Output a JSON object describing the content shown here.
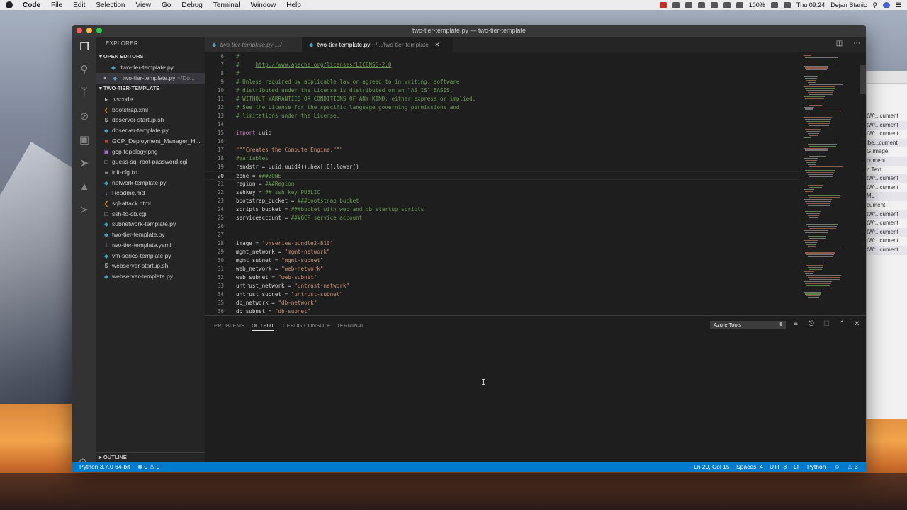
{
  "menubar": {
    "app": "Code",
    "items": [
      "File",
      "Edit",
      "Selection",
      "View",
      "Go",
      "Debug",
      "Terminal",
      "Window",
      "Help"
    ],
    "battery": "100%",
    "clock": "Thu 09:24",
    "user": "Dejan Stanic"
  },
  "window": {
    "title": "two-tier-template.py — two-tier-template"
  },
  "sidebar": {
    "title": "EXPLORER",
    "open_editors_header": "OPEN EDITORS",
    "open_editors": [
      {
        "name": "two-tier-template.py",
        "suffix": ""
      },
      {
        "name": "two-tier-template.py",
        "suffix": "~/Do..."
      }
    ],
    "project_header": "TWO-TIER-TEMPLATE",
    "files": [
      {
        "name": ".vscode",
        "icon": "folder",
        "color": "#cccccc"
      },
      {
        "name": "bootstrap.xml",
        "icon": "xml",
        "color": "#e37933"
      },
      {
        "name": "dbserver-startup.sh",
        "icon": "shell",
        "color": "#cccccc"
      },
      {
        "name": "dbserver-template.py",
        "icon": "python",
        "color": "#519aba"
      },
      {
        "name": "GCP_Deployment_Manager_H...",
        "icon": "pdf",
        "color": "#cc3e44"
      },
      {
        "name": "gcp-topology.png",
        "icon": "image",
        "color": "#a074c4"
      },
      {
        "name": "guess-sql-root-password.cgi",
        "icon": "file",
        "color": "#cccccc"
      },
      {
        "name": "init-cfg.txt",
        "icon": "text",
        "color": "#cccccc"
      },
      {
        "name": "network-template.py",
        "icon": "python",
        "color": "#519aba"
      },
      {
        "name": "Readme.md",
        "icon": "markdown",
        "color": "#519aba"
      },
      {
        "name": "sql-attack.html",
        "icon": "html",
        "color": "#e37933"
      },
      {
        "name": "ssh-to-db.cgi",
        "icon": "file",
        "color": "#cccccc"
      },
      {
        "name": "subnetwork-template.py",
        "icon": "python",
        "color": "#519aba"
      },
      {
        "name": "two-tier-template.py",
        "icon": "python",
        "color": "#519aba"
      },
      {
        "name": "two-tier-template.yaml",
        "icon": "yaml",
        "color": "#a074c4"
      },
      {
        "name": "vm-series-template.py",
        "icon": "python",
        "color": "#519aba"
      },
      {
        "name": "webserver-startup.sh",
        "icon": "shell",
        "color": "#cccccc"
      },
      {
        "name": "webserver-template.py",
        "icon": "python",
        "color": "#519aba"
      }
    ],
    "outline_header": "OUTLINE"
  },
  "tabs": [
    {
      "label": "two-tier-template.py",
      "path": ".../"
    },
    {
      "label": "two-tier-template.py",
      "path": "~/.../two-tier-template"
    }
  ],
  "code_lines": [
    {
      "n": "6",
      "segs": [
        {
          "t": "#",
          "c": "c-com"
        }
      ]
    },
    {
      "n": "7",
      "segs": [
        {
          "t": "#     ",
          "c": "c-com"
        },
        {
          "t": "http://www.apache.org/licenses/LICENSE-2.0",
          "c": "c-link"
        }
      ]
    },
    {
      "n": "8",
      "segs": [
        {
          "t": "#",
          "c": "c-com"
        }
      ]
    },
    {
      "n": "9",
      "segs": [
        {
          "t": "# Unless required by applicable law or agreed to in writing, software",
          "c": "c-com"
        }
      ]
    },
    {
      "n": "10",
      "segs": [
        {
          "t": "# distributed under the License is distributed on an \"AS IS\" BASIS,",
          "c": "c-com"
        }
      ]
    },
    {
      "n": "11",
      "segs": [
        {
          "t": "# WITHOUT WARRANTIES OR CONDITIONS OF ANY KIND, either express or implied.",
          "c": "c-com"
        }
      ]
    },
    {
      "n": "12",
      "segs": [
        {
          "t": "# See the License for the specific language governing permissions and",
          "c": "c-com"
        }
      ]
    },
    {
      "n": "13",
      "segs": [
        {
          "t": "# limitations under the License.",
          "c": "c-com"
        }
      ]
    },
    {
      "n": "14",
      "segs": []
    },
    {
      "n": "15",
      "segs": [
        {
          "t": "import",
          "c": "c-kw"
        },
        {
          "t": " uuid",
          "c": ""
        }
      ]
    },
    {
      "n": "16",
      "segs": []
    },
    {
      "n": "17",
      "segs": [
        {
          "t": "\"\"\"Creates the Compute Engine.\"\"\"",
          "c": "c-str"
        }
      ]
    },
    {
      "n": "18",
      "segs": [
        {
          "t": "#Variables",
          "c": "c-com"
        }
      ]
    },
    {
      "n": "19",
      "segs": [
        {
          "t": "randstr = uuid.uuid4().hex[:6].lower()",
          "c": ""
        }
      ]
    },
    {
      "n": "20",
      "segs": [
        {
          "t": "zone = ",
          "c": ""
        },
        {
          "t": "###ZONE",
          "c": "c-com"
        }
      ]
    },
    {
      "n": "21",
      "segs": [
        {
          "t": "region = ",
          "c": ""
        },
        {
          "t": "###Region",
          "c": "c-com"
        }
      ]
    },
    {
      "n": "22",
      "segs": [
        {
          "t": "sshkey = ",
          "c": ""
        },
        {
          "t": "## ssh key PUBLIC",
          "c": "c-com"
        }
      ]
    },
    {
      "n": "23",
      "segs": [
        {
          "t": "bootstrap_bucket = ",
          "c": ""
        },
        {
          "t": "###bootstrap bucket",
          "c": "c-com"
        }
      ]
    },
    {
      "n": "24",
      "segs": [
        {
          "t": "scripts_bucket = ",
          "c": ""
        },
        {
          "t": "###bucket with web and db startup scripts",
          "c": "c-com"
        }
      ]
    },
    {
      "n": "25",
      "segs": [
        {
          "t": "serviceaccount = ",
          "c": ""
        },
        {
          "t": "###GCP service account",
          "c": "c-com"
        }
      ]
    },
    {
      "n": "26",
      "segs": []
    },
    {
      "n": "27",
      "segs": []
    },
    {
      "n": "28",
      "segs": [
        {
          "t": "image = ",
          "c": ""
        },
        {
          "t": "\"vmseries-bundle2-810\"",
          "c": "c-str"
        }
      ]
    },
    {
      "n": "29",
      "segs": [
        {
          "t": "mgmt_network = ",
          "c": ""
        },
        {
          "t": "\"mgmt-network\"",
          "c": "c-str"
        }
      ]
    },
    {
      "n": "30",
      "segs": [
        {
          "t": "mgmt_subnet = ",
          "c": ""
        },
        {
          "t": "\"mgmt-subnet\"",
          "c": "c-str"
        }
      ]
    },
    {
      "n": "31",
      "segs": [
        {
          "t": "web_network = ",
          "c": ""
        },
        {
          "t": "\"web-network\"",
          "c": "c-str"
        }
      ]
    },
    {
      "n": "32",
      "segs": [
        {
          "t": "web_subnet = ",
          "c": ""
        },
        {
          "t": "\"web-subnet\"",
          "c": "c-str"
        }
      ]
    },
    {
      "n": "33",
      "segs": [
        {
          "t": "untrust_network = ",
          "c": ""
        },
        {
          "t": "\"untrust-network\"",
          "c": "c-str"
        }
      ]
    },
    {
      "n": "34",
      "segs": [
        {
          "t": "untrust_subnet = ",
          "c": ""
        },
        {
          "t": "\"untrust-subnet\"",
          "c": "c-str"
        }
      ]
    },
    {
      "n": "35",
      "segs": [
        {
          "t": "db_network = ",
          "c": ""
        },
        {
          "t": "\"db-network\"",
          "c": "c-str"
        }
      ]
    },
    {
      "n": "36",
      "segs": [
        {
          "t": "db_subnet = ",
          "c": ""
        },
        {
          "t": "\"db-subnet\"",
          "c": "c-str"
        }
      ]
    }
  ],
  "current_line": "20",
  "panel": {
    "tabs": [
      "PROBLEMS",
      "OUTPUT",
      "DEBUG CONSOLE",
      "TERMINAL"
    ],
    "active_tab": "OUTPUT",
    "output_channel": "Azure Tools"
  },
  "statusbar": {
    "interpreter": "Python 3.7.0 64-bit",
    "errors": "0",
    "warnings": "0",
    "cursor": "Ln 20, Col 15",
    "indent": "Spaces: 4",
    "encoding": "UTF-8",
    "eol": "LF",
    "language": "Python",
    "notifications": "3"
  },
  "background_window": {
    "rows": [
      "tWr...cument",
      "tWr...cument",
      "tWr...cument",
      "lbe...cument",
      "G image",
      "cument",
      "n Text",
      "tWr...cument",
      "tWr...cument",
      "ML",
      "cument",
      "tWr...cument",
      "tWr...cument",
      "tWr...cument",
      "tWr...cument",
      "tWr...cument"
    ],
    "row_prefix": "d"
  },
  "colors": {
    "accent": "#007acc",
    "editor_bg": "#1e1e1e",
    "sidebar_bg": "#252526",
    "comment": "#6a9955",
    "string": "#ce9178",
    "keyword": "#c586c0"
  }
}
